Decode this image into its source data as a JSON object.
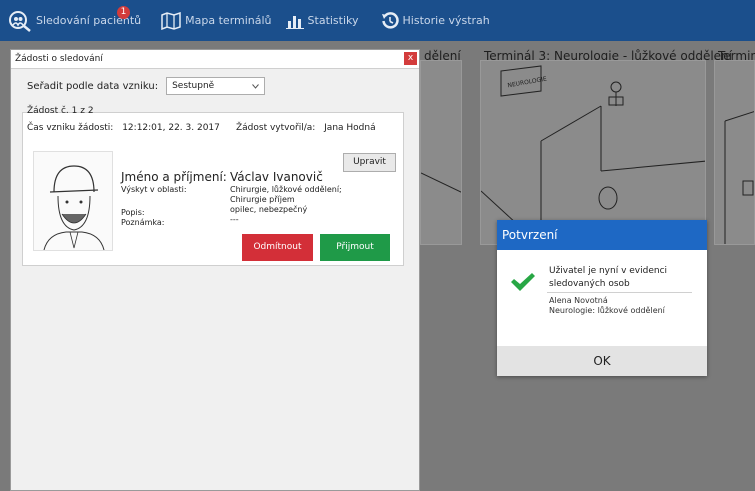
{
  "nav": {
    "items": [
      {
        "label": "Sledování pacientů",
        "icon": "people-search-icon"
      },
      {
        "label": "Mapa terminálů",
        "icon": "map-icon"
      },
      {
        "label": "Statistiky",
        "icon": "bar-chart-icon"
      },
      {
        "label": "Historie výstrah",
        "icon": "history-icon"
      }
    ],
    "badge_count": "1"
  },
  "terminals": {
    "left_title_fragment": "dělení",
    "terminal3_title": "Terminál 3: Neurologie - lůžkové oddělení",
    "right_title_fragment": "Terminá",
    "sign_text": "NEUROLOGIE"
  },
  "requests_window": {
    "title": "Žádosti o sledování",
    "close": "x",
    "sort_label": "Seřadit podle data vzniku:",
    "sort_value": "Sestupně",
    "counter": "Žádost č. 1 z 2",
    "created_label": "Čas vzniku žádosti:",
    "created_value": "12:12:01, 22. 3. 2017",
    "author_label": "Žádost vytvořil/a:",
    "author_value": "Jana Hodná",
    "edit_button": "Upravit",
    "name_label": "Jméno a příjmení:",
    "name_value": "Václav Ivanovič",
    "area_label": "Výskyt v oblasti:",
    "area_values": [
      "Chirurgie, lůžkové oddělení;",
      "Chirurgie příjem"
    ],
    "desc_label": "Popis:",
    "desc_value": "opilec, nebezpečný",
    "note_label": "Poznámka:",
    "note_value": "---",
    "reject_button": "Odmítnout",
    "accept_button": "Přijmout"
  },
  "confirm_dialog": {
    "title": "Potvrzení",
    "message": "Uživatel je nyní v evidenci sledovaných osob",
    "person": "Alena Novotná",
    "department": "Neurologie: lůžkové oddělení",
    "ok_button": "OK"
  },
  "colors": {
    "topbar": "#1b4f8c",
    "dialog_header": "#1e68c4",
    "reject": "#d32f38",
    "accept": "#1f9a48",
    "check": "#28a745"
  }
}
